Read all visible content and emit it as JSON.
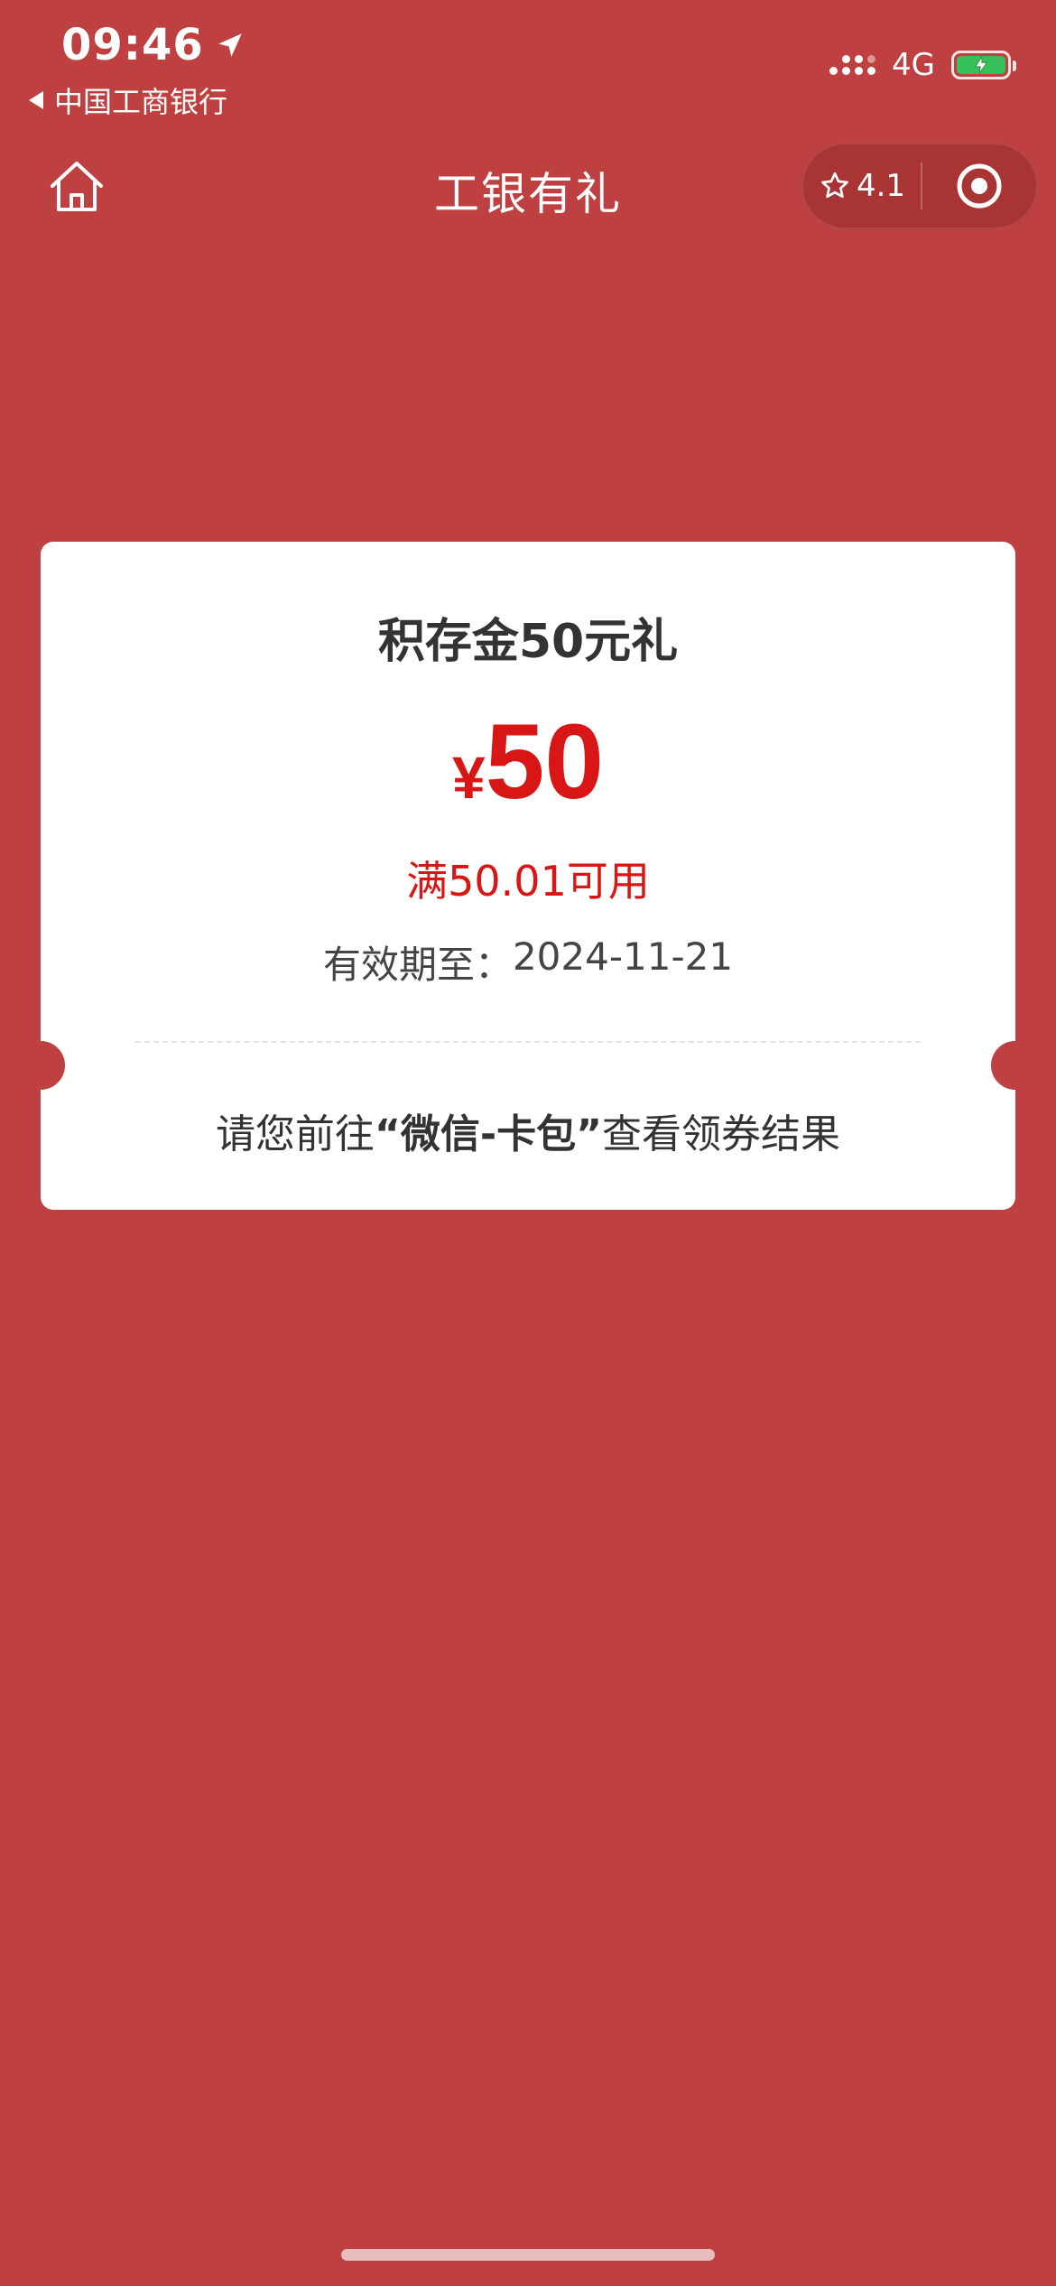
{
  "status_bar": {
    "time": "09:46",
    "back_app_label": "中国工商银行",
    "network": "4G",
    "icons": [
      "location-arrow-icon",
      "signal-icon",
      "battery-charging-icon"
    ]
  },
  "nav": {
    "title": "工银有礼",
    "rating": "4.1",
    "icons": [
      "home-icon",
      "star-icon",
      "target-icon"
    ]
  },
  "coupon": {
    "title": "积存金50元礼",
    "currency": "¥",
    "amount": "50",
    "condition": "满50.01可用",
    "validity_label": "有效期至：",
    "validity_date": "2024-11-21",
    "instruction_prefix": "请您前往",
    "instruction_highlight": "“微信-卡包”",
    "instruction_suffix": "查看领券结果"
  },
  "colors": {
    "background": "#BE4040",
    "accent_red": "#D81616",
    "card": "#FFFFFF",
    "text_dark": "#333333"
  }
}
